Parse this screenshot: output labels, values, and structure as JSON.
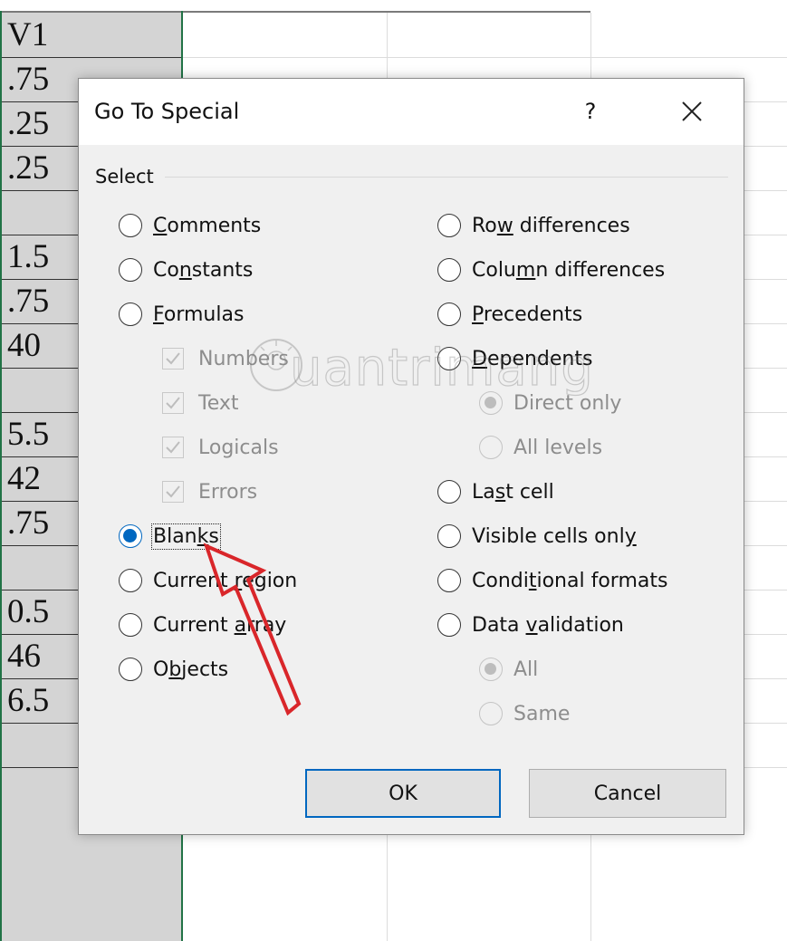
{
  "sheet": {
    "cells": [
      "V1",
      ".75",
      ".25",
      ".25",
      "",
      "1.5",
      ".75",
      "40",
      "",
      "5.5",
      "42",
      ".75",
      "",
      "0.5",
      "46",
      "6.5",
      ""
    ]
  },
  "dialog": {
    "title": "Go To Special",
    "help": "?",
    "group_label": "Select",
    "left_options": [
      {
        "pre": "",
        "key": "C",
        "post": "omments"
      },
      {
        "pre": "Co",
        "key": "n",
        "post": "stants"
      },
      {
        "pre": "",
        "key": "F",
        "post": "ormulas"
      }
    ],
    "checkboxes": [
      "Numbers",
      "Text",
      "Logicals",
      "Errors"
    ],
    "left_options2": [
      {
        "pre": "Blan",
        "key": "k",
        "post": "s"
      },
      {
        "pre": "Current ",
        "key": "r",
        "post": "egion"
      },
      {
        "pre": "Current ",
        "key": "a",
        "post": "rray"
      },
      {
        "pre": "O",
        "key": "b",
        "post": "jects"
      }
    ],
    "right_options": [
      {
        "pre": "Ro",
        "key": "w",
        "post": " differences"
      },
      {
        "pre": "Colu",
        "key": "m",
        "post": "n differences"
      },
      {
        "pre": "",
        "key": "P",
        "post": "recedents"
      },
      {
        "pre": "",
        "key": "D",
        "post": "ependents"
      }
    ],
    "dependents_sub": [
      "Direct only",
      "All levels"
    ],
    "right_options2": [
      {
        "pre": "La",
        "key": "s",
        "post": "t cell"
      },
      {
        "pre": "Visible cells onl",
        "key": "y",
        "post": ""
      },
      {
        "pre": "Condi",
        "key": "t",
        "post": "ional formats"
      },
      {
        "pre": "Data ",
        "key": "v",
        "post": "alidation"
      }
    ],
    "validation_sub": [
      "All",
      "Same"
    ],
    "ok_label": "OK",
    "cancel_label": "Cancel"
  },
  "colors": {
    "accent": "#0067c0",
    "selection": "#217346",
    "arrow": "#d9262a"
  },
  "watermark": "uantrimang"
}
